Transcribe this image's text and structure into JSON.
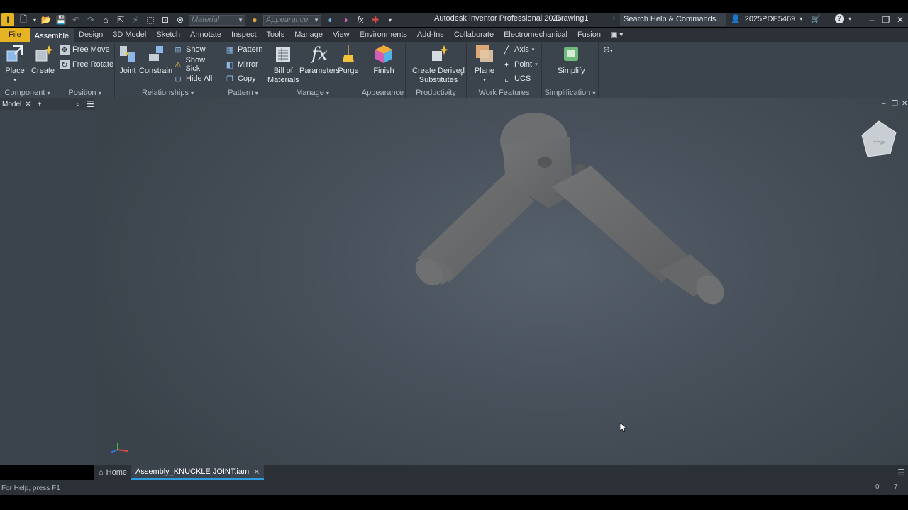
{
  "titlebar": {
    "app_logo": "I",
    "material_placeholder": "Material",
    "appearance_placeholder": "Appearance",
    "app_title": "Autodesk Inventor Professional 2026",
    "document_name": "Drawing1",
    "search_text": "Search Help & Commands...",
    "user_id": "2025PDE5469"
  },
  "menu": {
    "tabs": [
      "File",
      "Assemble",
      "Design",
      "3D Model",
      "Sketch",
      "Annotate",
      "Inspect",
      "Tools",
      "Manage",
      "View",
      "Environments",
      "Add-Ins",
      "Collaborate",
      "Electromechanical",
      "Fusion"
    ],
    "active": "Assemble"
  },
  "ribbon": {
    "component": {
      "label": "Component",
      "place": "Place",
      "create": "Create"
    },
    "position": {
      "label": "Position",
      "free_move": "Free Move",
      "free_rotate": "Free Rotate"
    },
    "relationships": {
      "label": "Relationships",
      "joint": "Joint",
      "constrain": "Constrain",
      "show": "Show",
      "show_sick": "Show Sick",
      "hide_all": "Hide All"
    },
    "pattern": {
      "label": "Pattern",
      "pattern": "Pattern",
      "mirror": "Mirror",
      "copy": "Copy"
    },
    "manage": {
      "label": "Manage",
      "bom_line1": "Bill of",
      "bom_line2": "Materials",
      "parameters": "Parameters",
      "purge": "Purge"
    },
    "appearance": {
      "label": "Appearance",
      "finish": "Finish"
    },
    "productivity": {
      "label": "Productivity",
      "cds_line1": "Create Derived",
      "cds_line2": "Substitutes"
    },
    "work_features": {
      "label": "Work Features",
      "plane": "Plane",
      "axis": "Axis",
      "point": "Point",
      "ucs": "UCS"
    },
    "simplification": {
      "label": "Simplification",
      "simplify": "Simplify"
    }
  },
  "browser": {
    "tab_label": "Model"
  },
  "viewcube": {
    "face": "TOP"
  },
  "doc_tabs": {
    "home": "Home",
    "document": "Assembly_KNUCKLE JOINT.iam"
  },
  "status": {
    "help_text": "For Help, press F1",
    "count_a": "0",
    "count_b": "7"
  },
  "colors": {
    "accent_yellow": "#e6b422",
    "ribbon_bg": "#3b434c",
    "dark_bar": "#2b3137",
    "active_tab_underline": "#2f9ee0",
    "model_gray": "#6c6d6e"
  }
}
